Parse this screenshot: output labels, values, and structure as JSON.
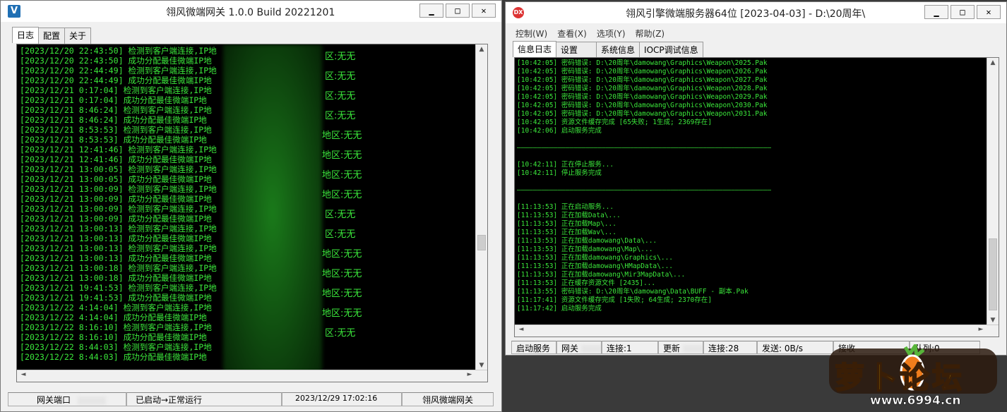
{
  "left_window": {
    "title": "翎风微端网关 1.0.0 Build 20221201",
    "icon_letter": "V",
    "buttons": {
      "min": "▁",
      "max": "□",
      "close": "✕"
    },
    "tabs": [
      "日志",
      "配置",
      "关于"
    ],
    "log_lines": [
      "[2023/12/20 22:43:50] 检测到客户端连接,IP地",
      "[2023/12/20 22:43:50] 成功分配最佳微端IP地",
      "[2023/12/20 22:44:49] 检测到客户端连接,IP地",
      "[2023/12/20 22:44:49] 成功分配最佳微端IP地",
      "[2023/12/21 0:17:04] 检测到客户端连接,IP地",
      "[2023/12/21 0:17:04] 成功分配最佳微端IP地",
      "[2023/12/21 8:46:24] 检测到客户端连接,IP地",
      "[2023/12/21 8:46:24] 成功分配最佳微端IP地",
      "[2023/12/21 8:53:53] 检测到客户端连接,IP地",
      "[2023/12/21 8:53:53] 成功分配最佳微端IP地",
      "[2023/12/21 12:41:46] 检测到客户端连接,IP地",
      "[2023/12/21 12:41:46] 成功分配最佳微端IP地",
      "[2023/12/21 13:00:05] 检测到客户端连接,IP地",
      "[2023/12/21 13:00:05] 成功分配最佳微端IP地",
      "[2023/12/21 13:00:09] 检测到客户端连接,IP地",
      "[2023/12/21 13:00:09] 成功分配最佳微端IP地",
      "[2023/12/21 13:00:09] 检测到客户端连接,IP地",
      "[2023/12/21 13:00:09] 成功分配最佳微端IP地",
      "[2023/12/21 13:00:13] 检测到客户端连接,IP地",
      "[2023/12/21 13:00:13] 成功分配最佳微端IP地",
      "[2023/12/21 13:00:13] 检测到客户端连接,IP地",
      "[2023/12/21 13:00:13] 成功分配最佳微端IP地",
      "[2023/12/21 13:00:18] 检测到客户端连接,IP地",
      "[2023/12/21 13:00:18] 成功分配最佳微端IP地",
      "[2023/12/21 19:41:53] 检测到客户端连接,IP地",
      "[2023/12/21 19:41:53] 成功分配最佳微端IP地",
      "[2023/12/22 4:14:04] 检测到客户端连接,IP地",
      "[2023/12/22 4:14:04] 成功分配最佳微端IP地",
      "[2023/12/22 8:16:10] 检测到客户端连接,IP地",
      "[2023/12/22 8:16:10] 成功分配最佳微端IP地",
      "[2023/12/22 8:44:03] 检测到客户端连接,IP地",
      "[2023/12/22 8:44:03] 成功分配最佳微端IP地"
    ],
    "region_suffixes": [
      "区:无无",
      "区:无无",
      "区:无无",
      "区:无无",
      "地区:无无",
      "地区:无无",
      "地区:无无",
      "地区:无无",
      "区:无无",
      "区:无无",
      "地区:无无",
      "地区:无无",
      "地区:无无",
      "地区:无无",
      "区:无无"
    ],
    "status": {
      "port_label": "网关端口",
      "state": "已启动→正常运行",
      "time": "2023/12/29 17:02:16",
      "name": "翎风微端网关"
    }
  },
  "right_window": {
    "title": "翎风引擎微端服务器64位 [2023-04-03] - D:\\20周年\\",
    "icon_letter": "DX",
    "buttons": {
      "min": "▁",
      "max": "□",
      "close": "✕"
    },
    "menu": [
      "控制(W)",
      "查看(X)",
      "选项(Y)",
      "帮助(Z)"
    ],
    "tabs": [
      "信息日志",
      "设置",
      "系统信息",
      "IOCP调试信息"
    ],
    "log_lines": [
      "[10:42:05] 密码错误: D:\\20周年\\damowang\\Graphics\\Weapon\\2025.Pak",
      "[10:42:05] 密码错误: D:\\20周年\\damowang\\Graphics\\Weapon\\2026.Pak",
      "[10:42:05] 密码错误: D:\\20周年\\damowang\\Graphics\\Weapon\\2027.Pak",
      "[10:42:05] 密码错误: D:\\20周年\\damowang\\Graphics\\Weapon\\2028.Pak",
      "[10:42:05] 密码错误: D:\\20周年\\damowang\\Graphics\\Weapon\\2029.Pak",
      "[10:42:05] 密码错误: D:\\20周年\\damowang\\Graphics\\Weapon\\2030.Pak",
      "[10:42:05] 密码错误: D:\\20周年\\damowang\\Graphics\\Weapon\\2031.Pak",
      "[10:42:05] 资源文件缓存完成 [65失败; 1生成; 2369存在]",
      "[10:42:06] 启动服务完成",
      "",
      "———————————————————————————————————————————————————————————————",
      "",
      "[10:42:11] 正在停止服务...",
      "[10:42:11] 停止服务完成",
      "",
      "———————————————————————————————————————————————————————————————",
      "",
      "[11:13:53] 正在启动服务...",
      "[11:13:53] 正在加载Data\\...",
      "[11:13:53] 正在加载Map\\...",
      "[11:13:53] 正在加载Wav\\...",
      "[11:13:53] 正在加载damowang\\Data\\...",
      "[11:13:53] 正在加载damowang\\Map\\...",
      "[11:13:53] 正在加载damowang\\Graphics\\...",
      "[11:13:53] 正在加载damowang\\HMapData\\...",
      "[11:13:53] 正在加载damowang\\Mir3MapData\\...",
      "[11:13:53] 正在缓存资源文件 [2435]...",
      "[11:13:55] 密码错误: D:\\20周年\\damowang\\Data\\BUFF - 副本.Pak",
      "[11:17:41] 资源文件缓存完成 [1失败; 64生成; 2370存在]",
      "[11:17:42] 启动服务完成"
    ],
    "status": {
      "start": "启动服务",
      "net": "网关",
      "conn1": "连接:1",
      "update": "更新",
      "conn2": "连接:28",
      "send": "发送: 0B/s",
      "recv": "接收",
      "queue": "队列:0"
    }
  },
  "watermark": {
    "brand": "萝卜论坛",
    "url": "www.6994.cn"
  },
  "colors": {
    "log_text": "#3be73b",
    "console_bg": "#000000"
  }
}
